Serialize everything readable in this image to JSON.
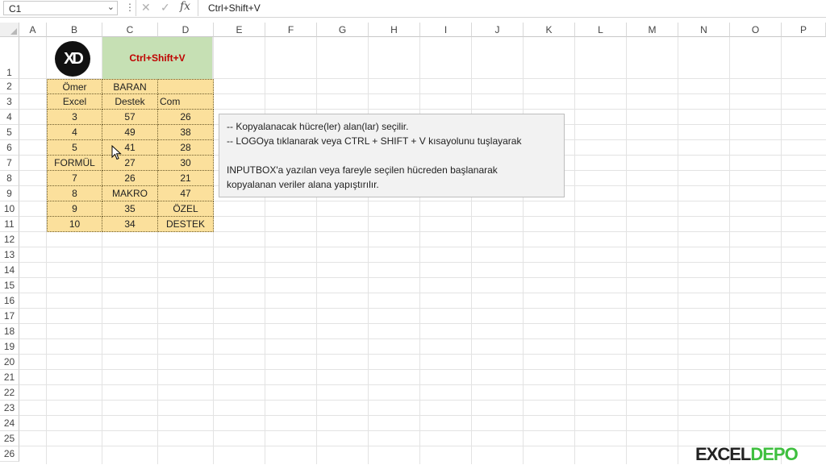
{
  "formula_bar": {
    "name_box": "C1",
    "more_icon": "vertical-dots",
    "cancel_icon": "cross-icon",
    "enter_icon": "check-icon",
    "fx_label": "fx",
    "formula": "Ctrl+Shift+V"
  },
  "columns": [
    "A",
    "B",
    "C",
    "D",
    "E",
    "F",
    "G",
    "H",
    "I",
    "J",
    "K",
    "L",
    "M",
    "N",
    "O",
    "P"
  ],
  "rows": [
    "1",
    "2",
    "3",
    "4",
    "5",
    "6",
    "7",
    "8",
    "9",
    "10",
    "11",
    "12",
    "13",
    "14",
    "15",
    "16",
    "17",
    "18",
    "19",
    "20",
    "21",
    "22",
    "23",
    "24",
    "25",
    "26"
  ],
  "cells": {
    "C1": "Ctrl+Shift+V",
    "table": [
      [
        "Ömer",
        "BARAN",
        ""
      ],
      [
        "Excel",
        "Destek",
        "Com"
      ],
      [
        "3",
        "57",
        "26"
      ],
      [
        "4",
        "49",
        "38"
      ],
      [
        "5",
        "41",
        "28"
      ],
      [
        "FORMÜL",
        "27",
        "30"
      ],
      [
        "7",
        "26",
        "21"
      ],
      [
        "8",
        "MAKRO",
        "47"
      ],
      [
        "9",
        "35",
        "ÖZEL"
      ],
      [
        "10",
        "34",
        "DESTEK"
      ]
    ]
  },
  "logo_text": "XD",
  "note": {
    "line1": "-- Kopyalanacak  hücre(ler) alan(lar)  seçilir.",
    "line2": "-- LOGOya tıklanarak  veya  CTRL + SHIFT + V  kısayolunu tuşlayarak",
    "line3": "INPUTBOX'a yazılan veya fareyle seçilen hücreden başlanarak",
    "line4": "kopyalanan veriler alana yapıştırılır."
  },
  "brand": {
    "part1": "EXCEL",
    "part2": "DEPO"
  },
  "colors": {
    "table_fill": "#fbe09c",
    "header_fill": "#c6e0b4",
    "hot_text": "#c00000"
  }
}
